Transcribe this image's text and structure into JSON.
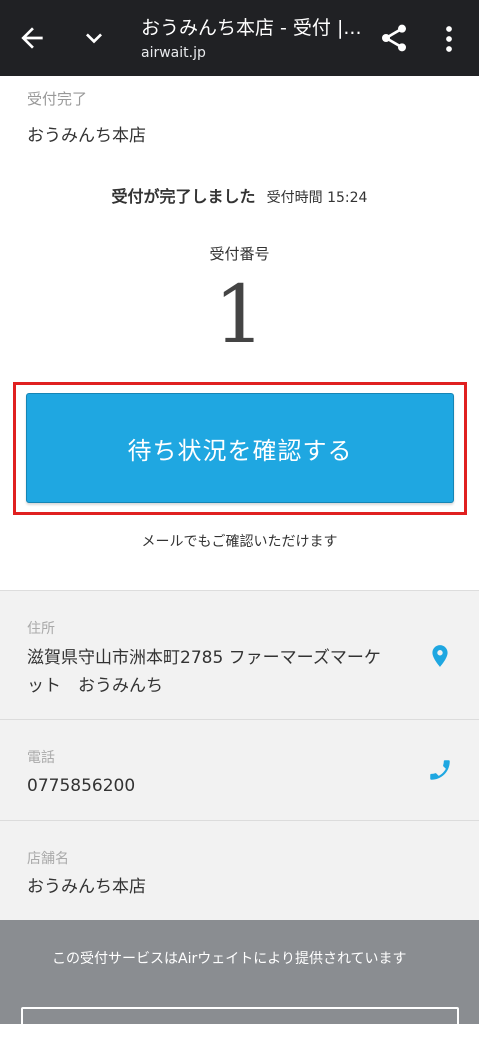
{
  "browser": {
    "title": "おうみんち本店 - 受付 |...",
    "url": "airwait.jp"
  },
  "header": {
    "status_label": "受付完了",
    "shop_name": "おうみんち本店"
  },
  "reception": {
    "complete_text": "受付が完了しました",
    "time_text": "受付時間 15:24",
    "number_label": "受付番号",
    "number": "1",
    "check_button": "待ち状況を確認する",
    "mail_note": "メールでもご確認いただけます"
  },
  "info": {
    "address_label": "住所",
    "address_line1": "滋賀県守山市洲本町2785 ファーマーズマーケ",
    "address_line2": "ット　おうみんち",
    "phone_label": "電話",
    "phone": "0775856200",
    "store_label": "店舗名",
    "store": "おうみんち本店"
  },
  "footer": {
    "text": "この受付サービスはAirウェイトにより提供されています"
  },
  "colors": {
    "accent": "#1fa7e1",
    "highlight": "#e02020",
    "topbar": "#202124"
  }
}
